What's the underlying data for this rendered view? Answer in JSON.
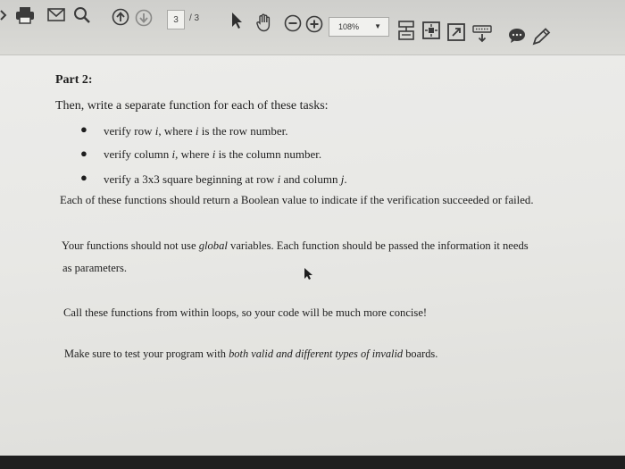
{
  "toolbar": {
    "page_current": "3",
    "page_total": "/ 3",
    "zoom_value": "108%",
    "icons": [
      "back-icon",
      "print-icon",
      "email-icon",
      "search-icon",
      "page-up-icon",
      "page-down-icon",
      "pointer-icon",
      "hand-icon",
      "zoom-out-icon",
      "zoom-in-icon",
      "read-mode-icon",
      "fit-page-icon",
      "fullscreen-icon",
      "keyboard-icon",
      "comment-icon",
      "pen-icon"
    ]
  },
  "document": {
    "heading": "Part 2:",
    "intro": "Then, write a separate function for each of these tasks:",
    "bullets": [
      {
        "pre": "verify row ",
        "var": "i",
        "mid": ", where ",
        "var2": "i",
        "post": " is the row number."
      },
      {
        "pre": "verify column ",
        "var": "i",
        "mid": ", where ",
        "var2": "i",
        "post": " is the column number."
      },
      {
        "pre": "verify a 3x3 square beginning at row ",
        "var": "i",
        "mid": " and column ",
        "var2": "j",
        "post": "."
      }
    ],
    "return_note": "Each of these functions should return a Boolean value to indicate if the verification succeeded or failed.",
    "global_pre": "Your functions should not use ",
    "global_em": "global",
    "global_post": " variables.  Each function should be passed the information it needs",
    "global_cont": "as parameters.",
    "loops_note": "Call these functions from within loops, so your code will be much more concise!",
    "test_pre": "Make sure to test your program with ",
    "test_em": "both valid and different types of invalid",
    "test_post": " boards."
  }
}
